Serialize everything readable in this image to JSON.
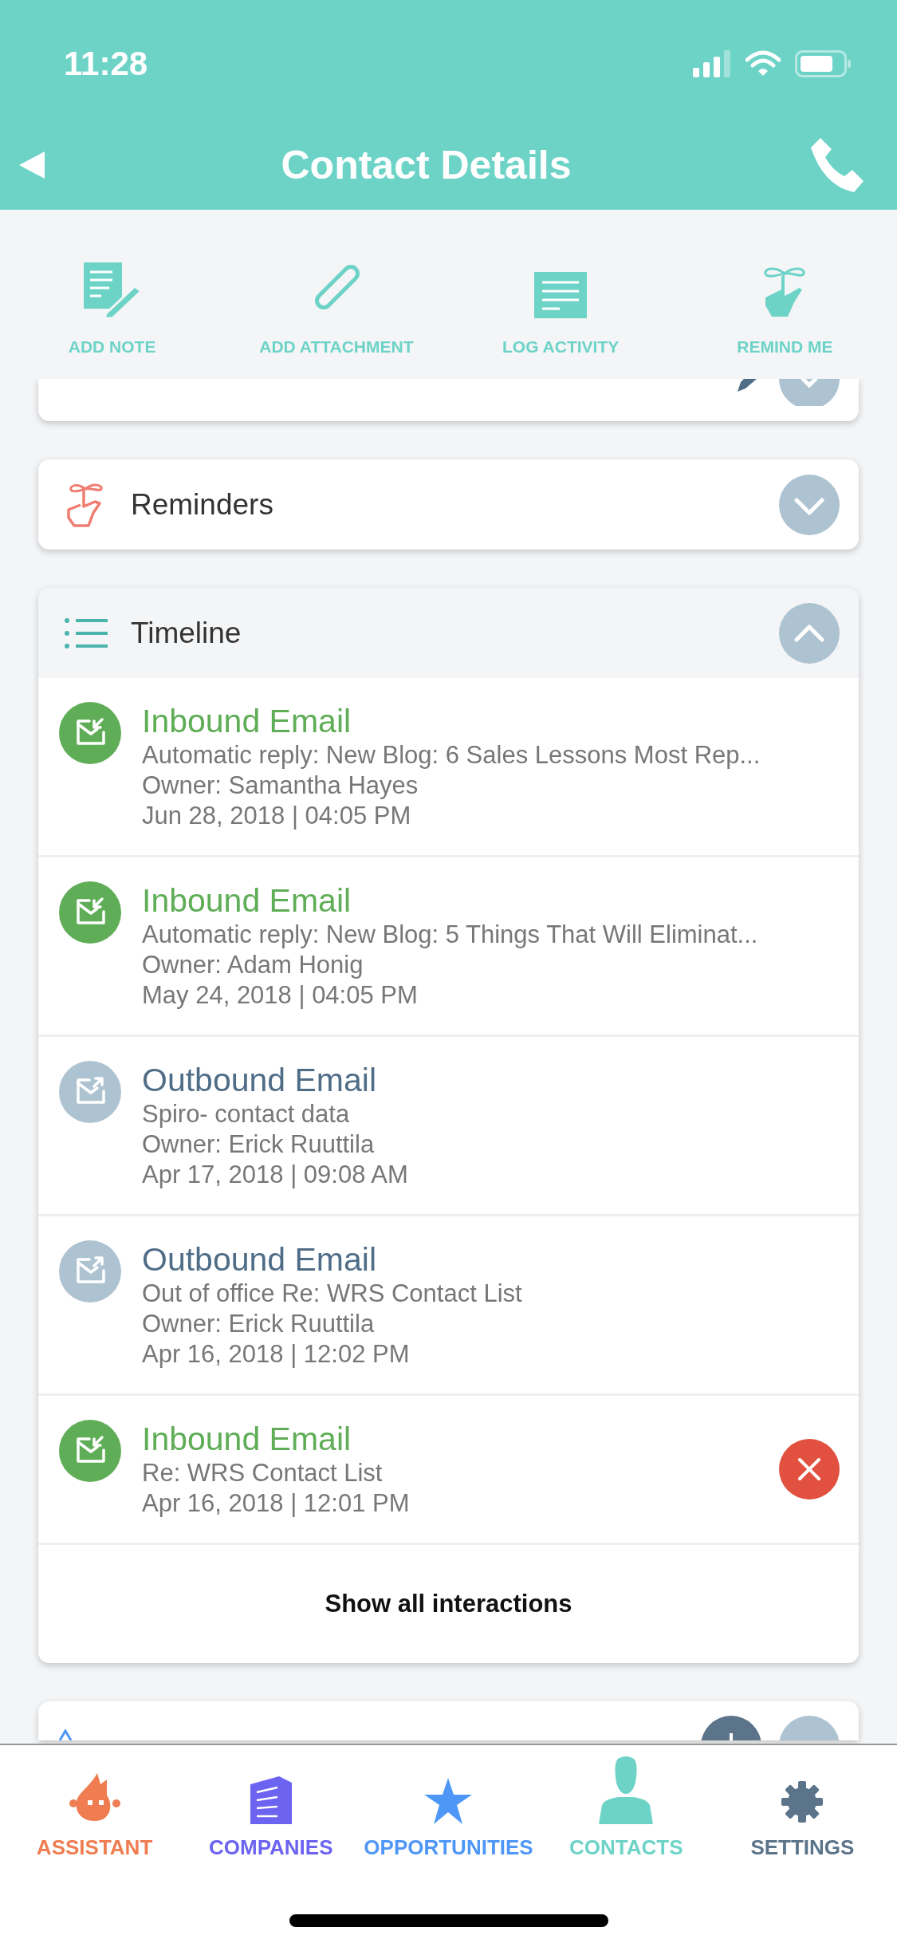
{
  "status_bar": {
    "time": "11:28"
  },
  "header": {
    "title": "Contact Details"
  },
  "actions": [
    {
      "kind": "note",
      "label": "ADD NOTE"
    },
    {
      "kind": "attachment",
      "label": "ADD ATTACHMENT"
    },
    {
      "kind": "activity",
      "label": "LOG ACTIVITY"
    },
    {
      "kind": "remind",
      "label": "REMIND ME"
    }
  ],
  "insights_card": {
    "expanded": false
  },
  "reminders_card": {
    "title": "Reminders",
    "expanded": false
  },
  "timeline": {
    "title": "Timeline",
    "expanded": true,
    "items": [
      {
        "kind": "inbound",
        "title": "Inbound Email",
        "lines": [
          "Automatic reply: New Blog: 6 Sales Lessons Most Rep...",
          "Owner: Samantha Hayes",
          "Jun 28, 2018 | 04:05 PM"
        ],
        "deletable": false
      },
      {
        "kind": "inbound",
        "title": "Inbound Email",
        "lines": [
          "Automatic reply: New Blog: 5 Things That Will Eliminat...",
          "Owner: Adam Honig",
          "May 24, 2018 | 04:05 PM"
        ],
        "deletable": false
      },
      {
        "kind": "outbound",
        "title": "Outbound Email",
        "lines": [
          "Spiro- contact data",
          "Owner: Erick Ruuttila",
          "Apr 17, 2018 | 09:08 AM"
        ],
        "deletable": false
      },
      {
        "kind": "outbound",
        "title": "Outbound Email",
        "lines": [
          "Out of office Re: WRS Contact List",
          "Owner: Erick Ruuttila",
          "Apr 16, 2018 | 12:02 PM"
        ],
        "deletable": false
      },
      {
        "kind": "inbound",
        "title": "Inbound Email",
        "lines": [
          "Re: WRS Contact List",
          "Apr 16, 2018 | 12:01 PM"
        ],
        "deletable": true
      }
    ],
    "show_all": "Show all interactions"
  },
  "opportunities_card": {
    "expanded": false
  },
  "tabs": [
    {
      "kind": "assistant",
      "label": "ASSISTANT",
      "color": "#ef7d51"
    },
    {
      "kind": "companies",
      "label": "COMPANIES",
      "color": "#6c63f0"
    },
    {
      "kind": "opportunities",
      "label": "OPPORTUNITIES",
      "color": "#4f97f7"
    },
    {
      "kind": "contacts",
      "label": "CONTACTS",
      "color": "#6dd3c7"
    },
    {
      "kind": "settings",
      "label": "SETTINGS",
      "color": "#5b748a"
    }
  ]
}
